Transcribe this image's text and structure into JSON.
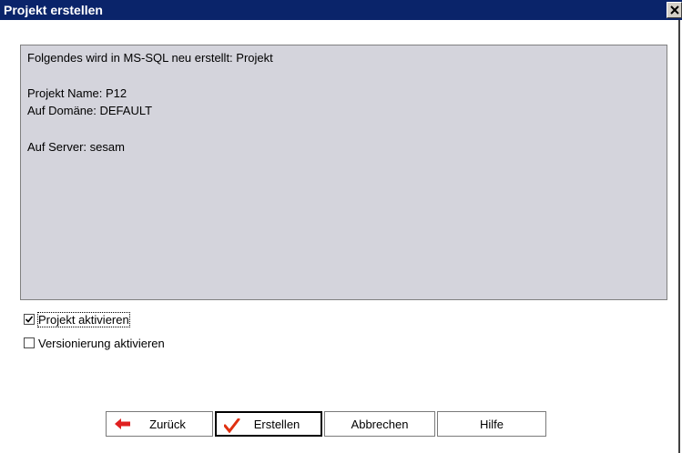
{
  "window": {
    "title": "Projekt erstellen",
    "close_icon": "close-icon"
  },
  "info": {
    "line1": "Folgendes wird in MS-SQL neu erstellt: Projekt",
    "line2": "Projekt Name: P12",
    "line3": "Auf Domäne: DEFAULT",
    "line4": "Auf Server: sesam"
  },
  "options": {
    "activate_project": {
      "label": "Projekt aktivieren",
      "checked": true
    },
    "activate_versioning": {
      "label": "Versionierung aktivieren",
      "checked": false
    }
  },
  "buttons": {
    "back": {
      "label": "Zurück",
      "icon": "arrow-left-icon",
      "icon_color": "#e02020"
    },
    "create": {
      "label": "Erstellen",
      "icon": "checkmark-icon",
      "icon_color": "#e03010"
    },
    "cancel": {
      "label": "Abbrechen"
    },
    "help": {
      "label": "Hilfe"
    }
  },
  "colors": {
    "titlebar": "#0a246a",
    "panel_background": "#d4d4dc"
  }
}
